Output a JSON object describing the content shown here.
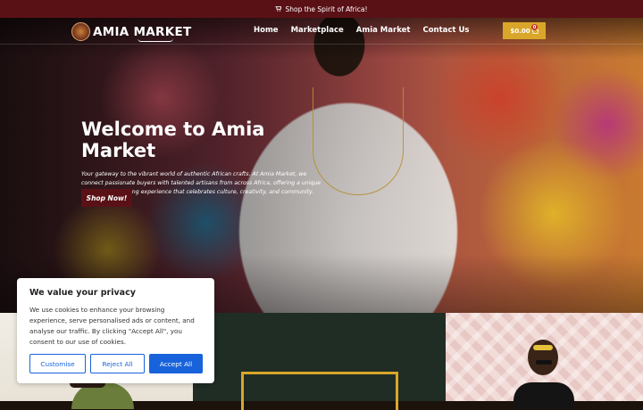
{
  "announcement": {
    "text": "Shop the Spirit of Africa!",
    "icon": "cart-icon"
  },
  "nav": {
    "logo_text": "AMIA MARKET",
    "items": [
      {
        "label": "Home"
      },
      {
        "label": "Marketplace"
      },
      {
        "label": "Amia Market"
      },
      {
        "label": "Contact Us"
      }
    ],
    "cart": {
      "amount": "$0.00",
      "count": "0"
    }
  },
  "hero": {
    "title": "Welcome to Amia Market",
    "description": "Your gateway to the vibrant world of authentic African crafts. At Amia Market, we connect passionate buyers with talented artisans from across Africa, offering a unique and secure shopping experience that celebrates culture, creativity, and community.",
    "cta_label": "Shop Now!"
  },
  "cookie": {
    "title": "We value your privacy",
    "body": "We use cookies to enhance your browsing experience, serve personalised ads or content, and analyse our traffic. By clicking \"Accept All\", you consent to our use of cookies.",
    "customise_label": "Customise",
    "reject_label": "Reject All",
    "accept_label": "Accept All"
  },
  "colors": {
    "brand_maroon": "#5a1116",
    "gold": "#d9a62a",
    "cookie_blue": "#1863dc",
    "dark_green": "#1f2d25"
  }
}
